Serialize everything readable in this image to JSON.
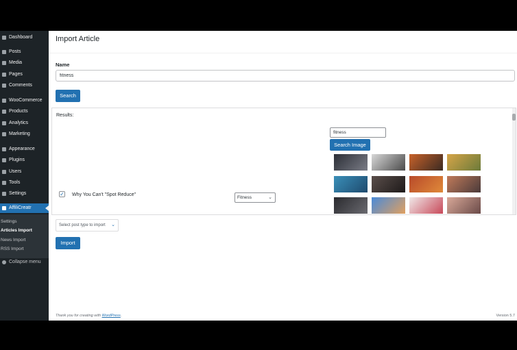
{
  "sidebar": {
    "items": [
      {
        "label": "Dashboard",
        "icon": "dashboard-icon"
      },
      {
        "label": "Posts",
        "icon": "pin-icon"
      },
      {
        "label": "Media",
        "icon": "media-icon"
      },
      {
        "label": "Pages",
        "icon": "page-icon"
      },
      {
        "label": "Comments",
        "icon": "comment-icon"
      },
      {
        "label": "WooCommerce",
        "icon": "woocommerce-icon"
      },
      {
        "label": "Products",
        "icon": "products-icon"
      },
      {
        "label": "Analytics",
        "icon": "analytics-icon"
      },
      {
        "label": "Marketing",
        "icon": "megaphone-icon"
      },
      {
        "label": "Appearance",
        "icon": "brush-icon"
      },
      {
        "label": "Plugins",
        "icon": "plugin-icon"
      },
      {
        "label": "Users",
        "icon": "users-icon"
      },
      {
        "label": "Tools",
        "icon": "wrench-icon"
      },
      {
        "label": "Settings",
        "icon": "settings-icon"
      },
      {
        "label": "AffiliCreatr",
        "icon": "plugin-logo-icon"
      }
    ],
    "submenu": [
      "Settings",
      "Articles Import",
      "News Import",
      "RSS Import"
    ],
    "collapse_label": "Collapse menu"
  },
  "page": {
    "title": "Import Article",
    "name_label": "Name",
    "name_value": "fitness",
    "search_button": "Search",
    "results_label": "Results:"
  },
  "result": {
    "checked": true,
    "title": "Why You Can't \"Spot Reduce\"",
    "category": "Fitness"
  },
  "image_search": {
    "query": "fitness",
    "button": "Search Image",
    "thumbnails": [
      "Dark gym workout photo",
      "Dumbbell grayscale photo",
      "Sunset stretching photo",
      "Outdoor jogging autumn photo",
      "Blue sneakers photo",
      "Woman boxing gym photo",
      "Sunset exercise photo",
      "Running on trail photo",
      "Dark gym figure photo",
      "Yoga sky silhouette photo",
      "Light studio workout photo",
      "Woman stretching photo"
    ],
    "thumb_colors": [
      [
        "#2b2e36",
        "#7a7c86"
      ],
      [
        "#d8d8d8",
        "#4a4a4a"
      ],
      [
        "#c8622a",
        "#3a2a22"
      ],
      [
        "#d6a548",
        "#6b7a3a"
      ],
      [
        "#3a8fb8",
        "#1e4a6e"
      ],
      [
        "#5a4e4a",
        "#1e1a1a"
      ],
      [
        "#b84a2a",
        "#e08a3a"
      ],
      [
        "#c07a5a",
        "#4a3a3a"
      ],
      [
        "#2a2a2e",
        "#6a6a70"
      ],
      [
        "#4a8ad8",
        "#e0a060"
      ],
      [
        "#f0e8e8",
        "#c84a5a"
      ],
      [
        "#d8a898",
        "#6a4a48"
      ]
    ]
  },
  "import": {
    "post_type_placeholder": "Select post type to import",
    "button": "Import"
  },
  "footer": {
    "thanks_prefix": "Thank you for creating with ",
    "thanks_link": "WordPress",
    "thanks_suffix": ".",
    "version": "Version 5.7"
  },
  "colors": {
    "accent": "#2271b1",
    "sidebar_bg": "#1d2327"
  }
}
